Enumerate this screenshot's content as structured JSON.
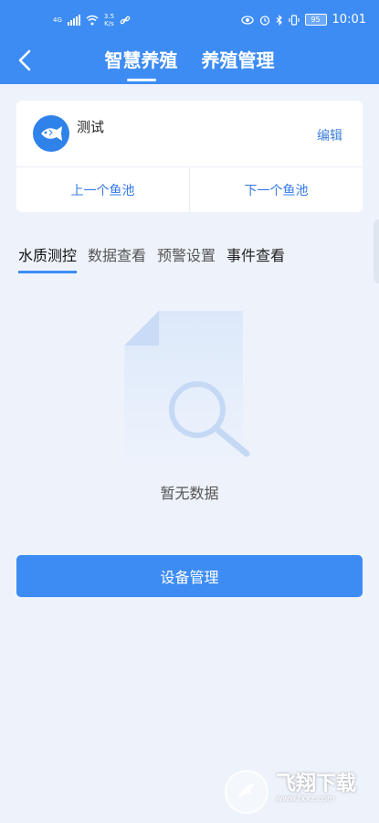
{
  "status_bar": {
    "network": "4G",
    "speed_value": "3.5",
    "speed_unit": "K/s",
    "battery": "95",
    "time": "10:01"
  },
  "nav": {
    "tabs": [
      {
        "label": "智慧养殖",
        "active": true
      },
      {
        "label": "养殖管理",
        "active": false
      }
    ]
  },
  "pond": {
    "name": "测试",
    "edit_label": "编辑",
    "prev_label": "上一个鱼池",
    "next_label": "下一个鱼池"
  },
  "sub_tabs": [
    {
      "label": "水质测控",
      "active": true
    },
    {
      "label": "数据查看",
      "active": false
    },
    {
      "label": "预警设置",
      "active": false
    },
    {
      "label": "事件查看",
      "active": false
    }
  ],
  "empty_state": {
    "text": "暂无数据",
    "icon": "document-search-icon"
  },
  "device_button_label": "设备管理",
  "watermark": {
    "title": "飞翔下载",
    "url": "www.fxxz.com"
  },
  "colors": {
    "primary": "#3d8cf4",
    "background": "#eef3fb",
    "link": "#3478e8"
  }
}
